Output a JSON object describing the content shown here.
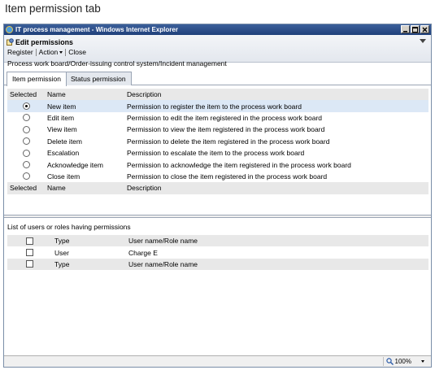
{
  "caption": "Item permission tab",
  "window": {
    "title": "IT process management - Windows Internet Explorer"
  },
  "header": {
    "title": "Edit permissions",
    "toolbar": {
      "register": "Register",
      "action": "Action",
      "close": "Close"
    }
  },
  "breadcrumb": "Process work board/Order-issuing control system/Incident management",
  "tabs": [
    {
      "label": "Item permission",
      "active": true
    },
    {
      "label": "Status permission",
      "active": false
    }
  ],
  "permissions": {
    "headers": {
      "selected": "Selected",
      "name": "Name",
      "description": "Description"
    },
    "rows": [
      {
        "name": "New item",
        "description": "Permission to register the item to the process work board",
        "selected": true
      },
      {
        "name": "Edit item",
        "description": "Permission to edit the item registered in the process work board",
        "selected": false
      },
      {
        "name": "View item",
        "description": "Permission to view the item registered in the process work board",
        "selected": false
      },
      {
        "name": "Delete item",
        "description": "Permission to delete the item registered in the process work board",
        "selected": false
      },
      {
        "name": "Escalation",
        "description": "Permission to escalate the item to the process work board",
        "selected": false
      },
      {
        "name": "Acknowledge item",
        "description": "Permission to acknowledge the item registered in the process work board",
        "selected": false
      },
      {
        "name": "Close item",
        "description": "Permission to close the item registered in the process work board",
        "selected": false
      }
    ]
  },
  "users": {
    "title": "List of users or roles having permissions",
    "headers": {
      "type": "Type",
      "name": "User name/Role name"
    },
    "rows": [
      {
        "type": "User",
        "name": "Charge E",
        "checked": false
      }
    ]
  },
  "statusbar": {
    "zoom": "100%"
  }
}
